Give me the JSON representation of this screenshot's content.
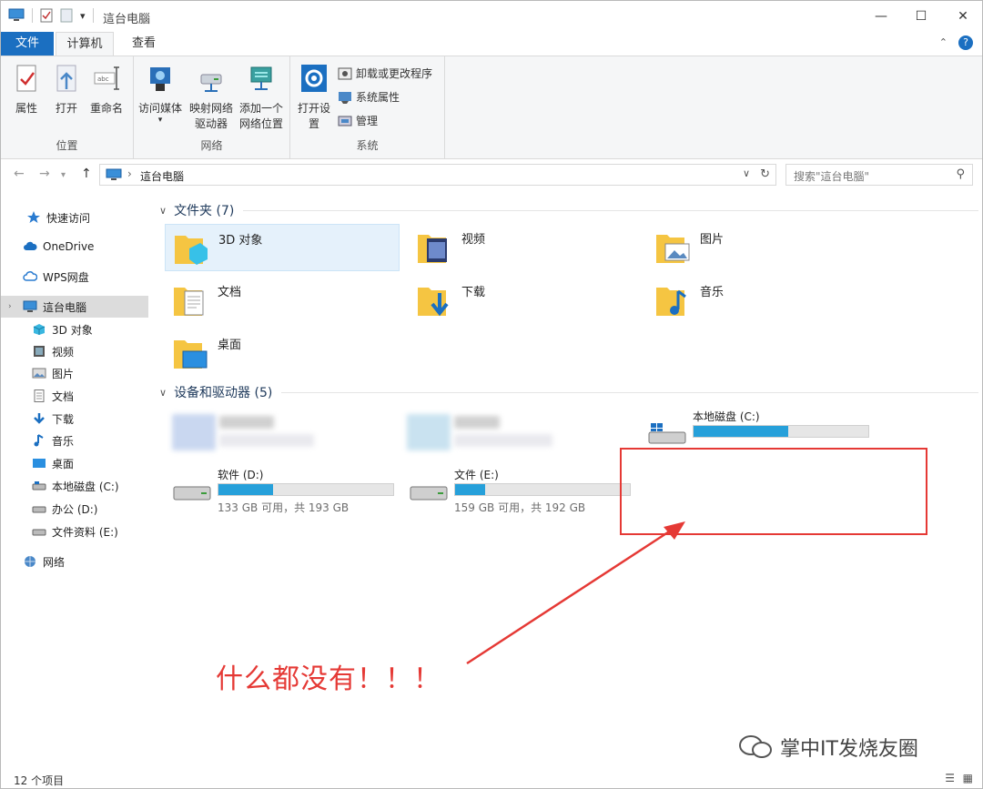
{
  "window": {
    "title": "這台电腦",
    "quick_access_more": "▾"
  },
  "ribbon_tabs": [
    "文件",
    "计算机",
    "查看"
  ],
  "ribbon": {
    "location_group": {
      "label": "位置",
      "buttons": [
        "属性",
        "打开",
        "重命名"
      ]
    },
    "network_group": {
      "label": "网络",
      "buttons": [
        "访问媒体",
        "映射网络驱动器",
        "添加一个网络位置"
      ]
    },
    "system_group": {
      "label": "系统",
      "open_settings": "打开设置",
      "items": [
        "卸载或更改程序",
        "系统属性",
        "管理"
      ]
    }
  },
  "address": {
    "path": "這台电腦",
    "search_placeholder": "搜索\"這台电腦\""
  },
  "sidebar": {
    "items": [
      {
        "label": "快速访问",
        "icon": "star-icon"
      },
      {
        "label": "OneDrive",
        "icon": "cloud-icon"
      },
      {
        "label": "WPS网盘",
        "icon": "wps-cloud-icon"
      },
      {
        "label": "這台电腦",
        "icon": "computer-icon",
        "selected": true
      },
      {
        "label": "3D 对象",
        "icon": "cube-icon"
      },
      {
        "label": "视频",
        "icon": "video-icon"
      },
      {
        "label": "图片",
        "icon": "picture-icon"
      },
      {
        "label": "文档",
        "icon": "document-icon"
      },
      {
        "label": "下载",
        "icon": "download-icon"
      },
      {
        "label": "音乐",
        "icon": "music-icon"
      },
      {
        "label": "桌面",
        "icon": "desktop-icon"
      },
      {
        "label": "本地磁盘 (C:)",
        "icon": "drive-icon"
      },
      {
        "label": "办公 (D:)",
        "icon": "drive-icon"
      },
      {
        "label": "文件资料 (E:)",
        "icon": "drive-icon"
      },
      {
        "label": "网络",
        "icon": "network-icon"
      }
    ]
  },
  "folders_section": {
    "title": "文件夹 (7)",
    "items": [
      "3D 对象",
      "视频",
      "图片",
      "文档",
      "下载",
      "音乐",
      "桌面"
    ]
  },
  "drives_section": {
    "title": "设备和驱动器 (5)",
    "drives": [
      {
        "label": "本地磁盘 (C:)",
        "usage": 0.54,
        "space": ""
      },
      {
        "label": "软件 (D:)",
        "usage": 0.31,
        "space": "133 GB 可用，共 193 GB"
      },
      {
        "label": "文件 (E:)",
        "usage": 0.17,
        "space": "159 GB 可用，共 192 GB"
      }
    ]
  },
  "annotation": {
    "note": "什么都没有！！！",
    "color": "#e53935"
  },
  "status_bar": {
    "count": "12 个项目"
  },
  "watermark": {
    "text": "掌中IT发烧友圈"
  },
  "colors": {
    "accent": "#1b6fc1",
    "drive_bar": "#26a0da",
    "selection": "#e5f1fb"
  }
}
